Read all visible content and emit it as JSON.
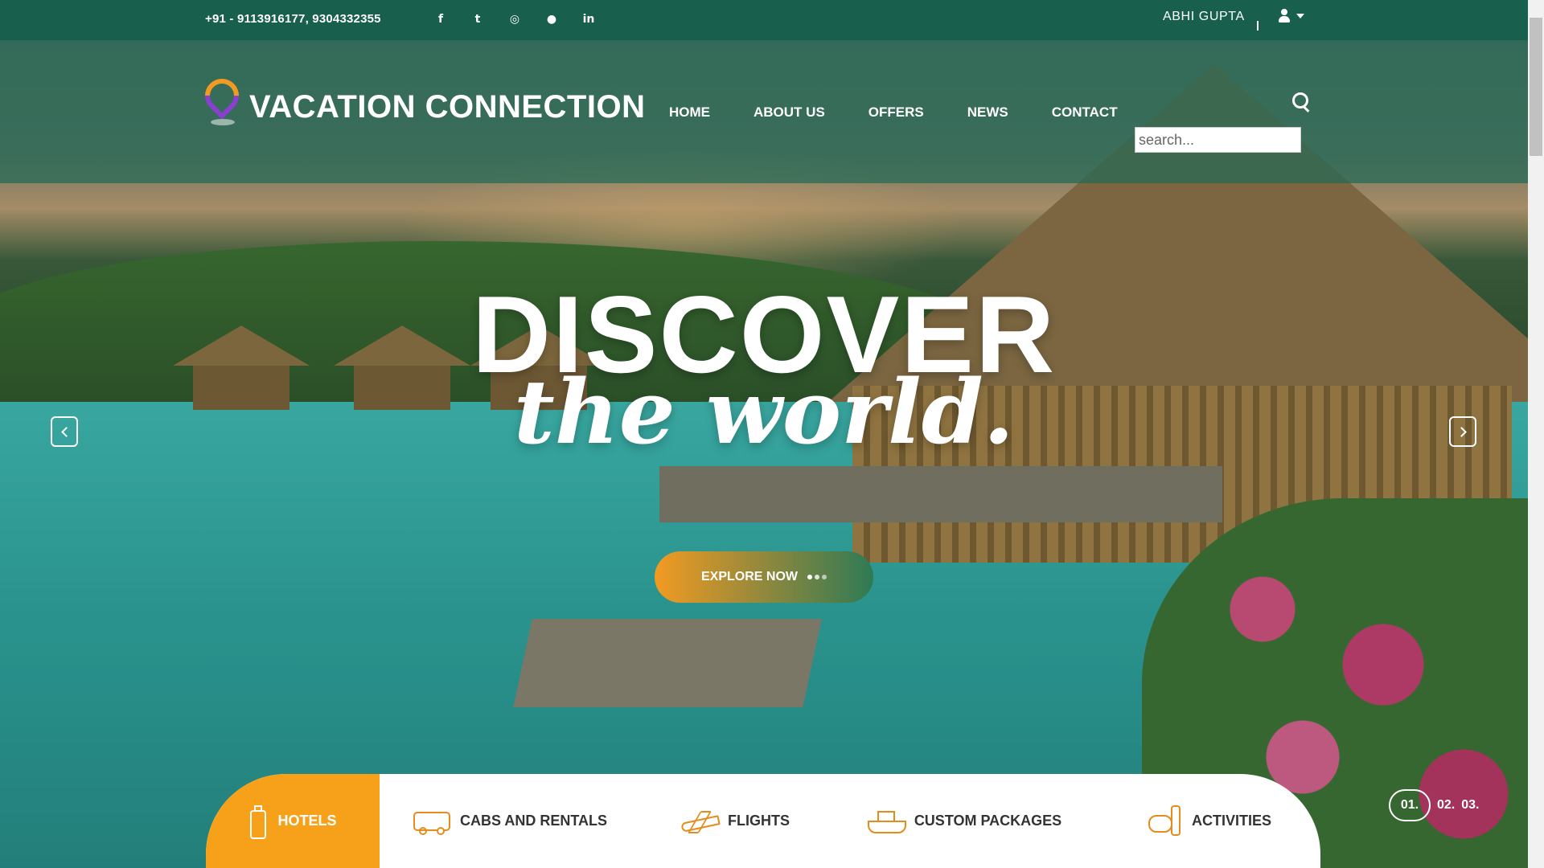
{
  "topbar": {
    "phone": "+91 - 9113916177, 9304332355",
    "social": [
      {
        "icon": "facebook-icon",
        "glyph": "f"
      },
      {
        "icon": "twitter-icon",
        "glyph": "t"
      },
      {
        "icon": "instagram-icon",
        "glyph": "◎"
      },
      {
        "icon": "tripadvisor-icon",
        "glyph": "●"
      },
      {
        "icon": "linkedin-icon",
        "glyph": "in"
      }
    ],
    "user_name": "ABHI GUPTA"
  },
  "header": {
    "brand": "VACATION CONNECTION",
    "nav": [
      "HOME",
      "ABOUT US",
      "OFFERS",
      "NEWS",
      "CONTACT"
    ],
    "search_placeholder": "search..."
  },
  "hero": {
    "title": "DISCOVER",
    "subtitle": "the world.",
    "cta": "EXPLORE NOW"
  },
  "slider": {
    "pages": [
      "01.",
      "02.",
      "03."
    ],
    "active_index": 0
  },
  "booking_tabs": [
    {
      "label": "HOTELS",
      "icon": "suitcase-icon",
      "active": true
    },
    {
      "label": "CABS AND RENTALS",
      "icon": "bus-icon",
      "active": false
    },
    {
      "label": "FLIGHTS",
      "icon": "plane-icon",
      "active": false
    },
    {
      "label": "CUSTOM PACKAGES",
      "icon": "ship-icon",
      "active": false
    },
    {
      "label": "ACTIVITIES",
      "icon": "snorkel-icon",
      "active": false
    }
  ],
  "colors": {
    "topbar": "#195f4e",
    "accent": "#f7a11a",
    "icon_orange": "#e48c1d"
  }
}
